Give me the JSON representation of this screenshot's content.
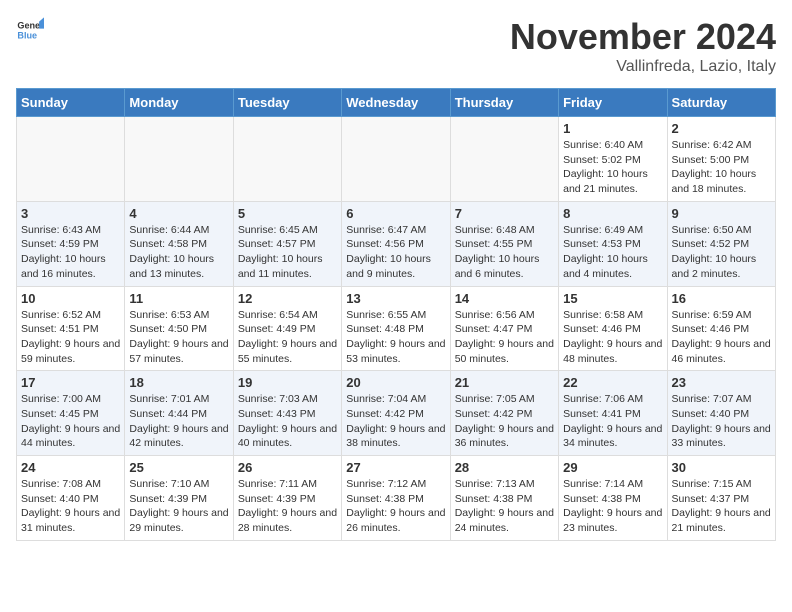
{
  "header": {
    "logo_general": "General",
    "logo_blue": "Blue",
    "month": "November 2024",
    "location": "Vallinfreda, Lazio, Italy"
  },
  "days_of_week": [
    "Sunday",
    "Monday",
    "Tuesday",
    "Wednesday",
    "Thursday",
    "Friday",
    "Saturday"
  ],
  "weeks": [
    [
      {
        "day": "",
        "empty": true
      },
      {
        "day": "",
        "empty": true
      },
      {
        "day": "",
        "empty": true
      },
      {
        "day": "",
        "empty": true
      },
      {
        "day": "",
        "empty": true
      },
      {
        "day": "1",
        "sunrise": "Sunrise: 6:40 AM",
        "sunset": "Sunset: 5:02 PM",
        "daylight": "Daylight: 10 hours and 21 minutes."
      },
      {
        "day": "2",
        "sunrise": "Sunrise: 6:42 AM",
        "sunset": "Sunset: 5:00 PM",
        "daylight": "Daylight: 10 hours and 18 minutes."
      }
    ],
    [
      {
        "day": "3",
        "sunrise": "Sunrise: 6:43 AM",
        "sunset": "Sunset: 4:59 PM",
        "daylight": "Daylight: 10 hours and 16 minutes."
      },
      {
        "day": "4",
        "sunrise": "Sunrise: 6:44 AM",
        "sunset": "Sunset: 4:58 PM",
        "daylight": "Daylight: 10 hours and 13 minutes."
      },
      {
        "day": "5",
        "sunrise": "Sunrise: 6:45 AM",
        "sunset": "Sunset: 4:57 PM",
        "daylight": "Daylight: 10 hours and 11 minutes."
      },
      {
        "day": "6",
        "sunrise": "Sunrise: 6:47 AM",
        "sunset": "Sunset: 4:56 PM",
        "daylight": "Daylight: 10 hours and 9 minutes."
      },
      {
        "day": "7",
        "sunrise": "Sunrise: 6:48 AM",
        "sunset": "Sunset: 4:55 PM",
        "daylight": "Daylight: 10 hours and 6 minutes."
      },
      {
        "day": "8",
        "sunrise": "Sunrise: 6:49 AM",
        "sunset": "Sunset: 4:53 PM",
        "daylight": "Daylight: 10 hours and 4 minutes."
      },
      {
        "day": "9",
        "sunrise": "Sunrise: 6:50 AM",
        "sunset": "Sunset: 4:52 PM",
        "daylight": "Daylight: 10 hours and 2 minutes."
      }
    ],
    [
      {
        "day": "10",
        "sunrise": "Sunrise: 6:52 AM",
        "sunset": "Sunset: 4:51 PM",
        "daylight": "Daylight: 9 hours and 59 minutes."
      },
      {
        "day": "11",
        "sunrise": "Sunrise: 6:53 AM",
        "sunset": "Sunset: 4:50 PM",
        "daylight": "Daylight: 9 hours and 57 minutes."
      },
      {
        "day": "12",
        "sunrise": "Sunrise: 6:54 AM",
        "sunset": "Sunset: 4:49 PM",
        "daylight": "Daylight: 9 hours and 55 minutes."
      },
      {
        "day": "13",
        "sunrise": "Sunrise: 6:55 AM",
        "sunset": "Sunset: 4:48 PM",
        "daylight": "Daylight: 9 hours and 53 minutes."
      },
      {
        "day": "14",
        "sunrise": "Sunrise: 6:56 AM",
        "sunset": "Sunset: 4:47 PM",
        "daylight": "Daylight: 9 hours and 50 minutes."
      },
      {
        "day": "15",
        "sunrise": "Sunrise: 6:58 AM",
        "sunset": "Sunset: 4:46 PM",
        "daylight": "Daylight: 9 hours and 48 minutes."
      },
      {
        "day": "16",
        "sunrise": "Sunrise: 6:59 AM",
        "sunset": "Sunset: 4:46 PM",
        "daylight": "Daylight: 9 hours and 46 minutes."
      }
    ],
    [
      {
        "day": "17",
        "sunrise": "Sunrise: 7:00 AM",
        "sunset": "Sunset: 4:45 PM",
        "daylight": "Daylight: 9 hours and 44 minutes."
      },
      {
        "day": "18",
        "sunrise": "Sunrise: 7:01 AM",
        "sunset": "Sunset: 4:44 PM",
        "daylight": "Daylight: 9 hours and 42 minutes."
      },
      {
        "day": "19",
        "sunrise": "Sunrise: 7:03 AM",
        "sunset": "Sunset: 4:43 PM",
        "daylight": "Daylight: 9 hours and 40 minutes."
      },
      {
        "day": "20",
        "sunrise": "Sunrise: 7:04 AM",
        "sunset": "Sunset: 4:42 PM",
        "daylight": "Daylight: 9 hours and 38 minutes."
      },
      {
        "day": "21",
        "sunrise": "Sunrise: 7:05 AM",
        "sunset": "Sunset: 4:42 PM",
        "daylight": "Daylight: 9 hours and 36 minutes."
      },
      {
        "day": "22",
        "sunrise": "Sunrise: 7:06 AM",
        "sunset": "Sunset: 4:41 PM",
        "daylight": "Daylight: 9 hours and 34 minutes."
      },
      {
        "day": "23",
        "sunrise": "Sunrise: 7:07 AM",
        "sunset": "Sunset: 4:40 PM",
        "daylight": "Daylight: 9 hours and 33 minutes."
      }
    ],
    [
      {
        "day": "24",
        "sunrise": "Sunrise: 7:08 AM",
        "sunset": "Sunset: 4:40 PM",
        "daylight": "Daylight: 9 hours and 31 minutes."
      },
      {
        "day": "25",
        "sunrise": "Sunrise: 7:10 AM",
        "sunset": "Sunset: 4:39 PM",
        "daylight": "Daylight: 9 hours and 29 minutes."
      },
      {
        "day": "26",
        "sunrise": "Sunrise: 7:11 AM",
        "sunset": "Sunset: 4:39 PM",
        "daylight": "Daylight: 9 hours and 28 minutes."
      },
      {
        "day": "27",
        "sunrise": "Sunrise: 7:12 AM",
        "sunset": "Sunset: 4:38 PM",
        "daylight": "Daylight: 9 hours and 26 minutes."
      },
      {
        "day": "28",
        "sunrise": "Sunrise: 7:13 AM",
        "sunset": "Sunset: 4:38 PM",
        "daylight": "Daylight: 9 hours and 24 minutes."
      },
      {
        "day": "29",
        "sunrise": "Sunrise: 7:14 AM",
        "sunset": "Sunset: 4:38 PM",
        "daylight": "Daylight: 9 hours and 23 minutes."
      },
      {
        "day": "30",
        "sunrise": "Sunrise: 7:15 AM",
        "sunset": "Sunset: 4:37 PM",
        "daylight": "Daylight: 9 hours and 21 minutes."
      }
    ]
  ]
}
